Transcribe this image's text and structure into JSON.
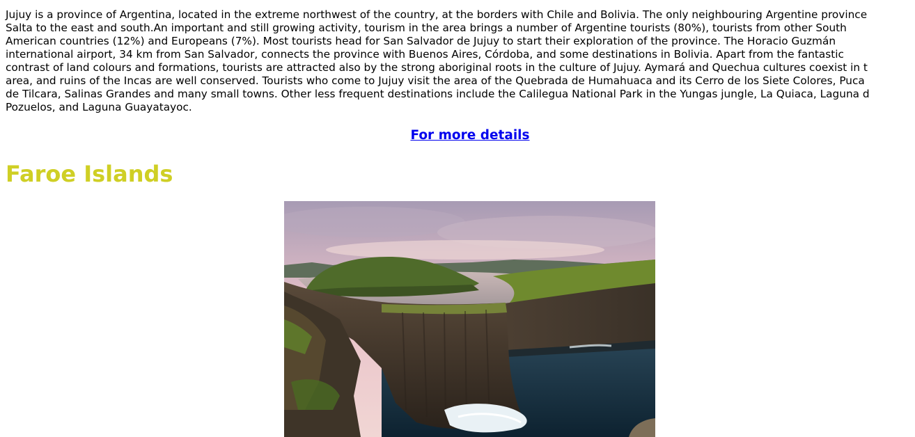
{
  "content": {
    "description_lines": [
      "Jujuy is a province of Argentina, located in the extreme northwest of the country, at the borders with Chile and Bolivia. The only neighbouring Argentine province",
      "Salta to the east and south.An important and still growing activity, tourism in the area brings a number of Argentine tourists (80%), tourists from other South",
      "American countries (12%) and Europeans (7%). Most tourists head for San Salvador de Jujuy to start their exploration of the province. The Horacio Guzmán",
      "international airport, 34 km from San Salvador, connects the province with Buenos Aires, Córdoba, and some destinations in Bolivia. Apart from the fantastic",
      "contrast of land colours and formations, tourists are attracted also by the strong aboriginal roots in the culture of Jujuy. Aymará and Quechua cultures coexist in t",
      "area, and ruins of the Incas are well conserved. Tourists who come to Jujuy visit the area of the Quebrada de Humahuaca and its Cerro de los Siete Colores, Puca",
      "de Tilcara, Salinas Grandes and many small towns. Other less frequent destinations include the Calilegua National Park in the Yungas jungle, La Quiaca, Laguna d",
      "Pozuelos, and Laguna Guayatayoc."
    ],
    "more_link": "For more details",
    "section_title": "Faroe Islands"
  },
  "colors": {
    "link": "#0000ee",
    "section_title": "#cfcf25",
    "text": "#000000"
  }
}
